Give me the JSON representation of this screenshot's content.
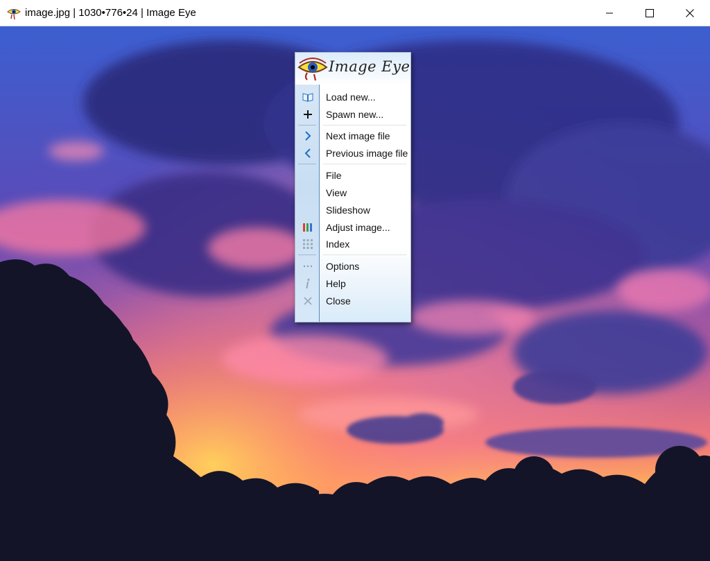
{
  "window": {
    "title": "image.jpg | 1030•776•24 | Image Eye",
    "controls": {
      "minimize": "minimize-icon",
      "maximize": "maximize-icon",
      "close": "close-icon"
    }
  },
  "menu": {
    "logo_text": "Image Eye",
    "items": [
      {
        "label": "Load new...",
        "icon": "open-book-icon"
      },
      {
        "label": "Spawn new...",
        "icon": "plus-icon"
      },
      {
        "label": "Next image file",
        "icon": "chevron-right-icon"
      },
      {
        "label": "Previous image file",
        "icon": "chevron-left-icon"
      },
      {
        "label": "File",
        "icon": ""
      },
      {
        "label": "View",
        "icon": ""
      },
      {
        "label": "Slideshow",
        "icon": ""
      },
      {
        "label": "Adjust image...",
        "icon": "color-bars-icon"
      },
      {
        "label": "Index",
        "icon": "grid-icon"
      },
      {
        "label": "Options",
        "icon": "ellipsis-icon"
      },
      {
        "label": "Help",
        "icon": "info-icon"
      },
      {
        "label": "Close",
        "icon": "close-x-icon"
      }
    ]
  },
  "colors": {
    "accent": "#1e6fc1",
    "strip_border": "#5a8ab8"
  }
}
